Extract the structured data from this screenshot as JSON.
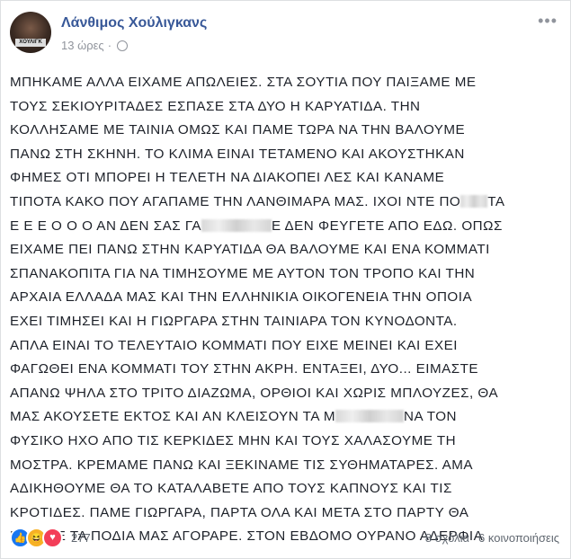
{
  "author": {
    "name": "Λάνθιμος Χούλιγκανς",
    "avatar_caption": "ΧΟΥΛΙΓΚ"
  },
  "time": "13 ώρες",
  "separator": "·",
  "menu_icon": "•••",
  "post_lines": [
    [
      "ΜΠΗΚΑΜΕ ΑΛΛΑ ΕΙΧΑΜΕ ΑΠΩΛΕΙΕΣ. ΣΤΑ ΣΟΥΤΙΑ ΠΟΥ ΠΑΙΞΑΜΕ ΜΕ"
    ],
    [
      "ΤΟΥΣ ΣΕΚΙΟΥΡΙΤΑΔΕΣ ΕΣΠΑΣΕ ΣΤΑ ΔΥΟ Η ΚΑΡΥΑΤΙΔΑ. ΤΗΝ"
    ],
    [
      "ΚΟΛΛΗΣΑΜΕ ΜΕ ΤΑΙΝΙΑ ΟΜΩΣ ΚΑΙ ΠΑΜΕ ΤΩΡΑ ΝΑ ΤΗΝ ΒΑΛΟΥΜΕ"
    ],
    [
      "ΠΑΝΩ ΣΤΗ ΣΚΗΝΗ. ΤΟ ΚΛΙΜΑ ΕΙΝΑΙ ΤΕΤΑΜΕΝΟ ΚΑΙ ΑΚΟΥΣΤΗΚΑΝ"
    ],
    [
      "ΦΗΜΕΣ ΟΤΙ ΜΠΟΡΕΙ Η ΤΕΛΕΤΗ ΝΑ ΔΙΑΚΟΠΕΙ ΛΕΣ ΚΑΙ ΚΑΝΑΜΕ"
    ],
    [
      "ΤΙΠΟΤΑ ΚΑΚΟ ΠΟΥ ΑΓΑΠΑΜΕ ΤΗΝ ΛΑΝΘΙΜΑΡΑ ΜΑΣ. ΙΧΟΙ ΝΤΕ ΠΟ",
      "ΤΑ"
    ],
    [
      "Ε Ε Ε Ο Ο Ο ΑΝ ΔΕΝ ΣΑΣ ΓΑ",
      "Ε ΔΕΝ ΦΕΥΓΕΤΕ ΑΠΟ ΕΔΩ. ΟΠΩΣ"
    ],
    [
      "ΕΙΧΑΜΕ ΠΕΙ ΠΑΝΩ ΣΤΗΝ ΚΑΡΥΑΤΙΔΑ ΘΑ ΒΑΛΟΥΜΕ ΚΑΙ ΕΝΑ ΚΟΜΜΑΤΙ"
    ],
    [
      "ΣΠΑΝΑΚΟΠΙΤΑ ΓΙΑ ΝΑ ΤΙΜΗΣΟΥΜΕ ΜΕ ΑΥΤΟΝ ΤΟΝ ΤΡΟΠΟ ΚΑΙ ΤΗΝ"
    ],
    [
      "ΑΡΧΑΙΑ ΕΛΛΑΔΑ ΜΑΣ ΚΑΙ ΤΗΝ ΕΛΛΗΝΙΚΙΑ ΟΙΚΟΓΕΝΕΙΑ ΤΗΝ ΟΠΟΙΑ"
    ],
    [
      "ΕΧΕΙ ΤΙΜΗΣΕΙ ΚΑΙ Η ΓΙΩΡΓΑΡΑ ΣΤΗΝ ΤΑΙΝΙΑΡΑ ΤΟΝ ΚΥΝΟΔΟΝΤΑ."
    ],
    [
      "ΑΠΛΑ ΕΙΝΑΙ ΤΟ ΤΕΛΕΥΤΑΙΟ ΚΟΜΜΑΤΙ ΠΟΥ ΕΙΧΕ ΜΕΙΝΕΙ ΚΑΙ ΕΧΕΙ"
    ],
    [
      "ΦΑΓΩΘΕΙ ΕΝΑ ΚΟΜΜΑΤΙ ΤΟΥ ΣΤΗΝ ΑΚΡΗ. ΕΝΤΑΞΕΙ, ΔΥΟ... ΕΙΜΑΣΤΕ"
    ],
    [
      "ΑΠΑΝΩ ΨΗΛΑ ΣΤΟ ΤΡΙΤΟ ΔΙΑΖΩΜΑ, ΟΡΘΙΟΙ ΚΑΙ ΧΩΡΙΣ ΜΠΛΟΥΖΕΣ, ΘΑ"
    ],
    [
      "ΜΑΣ ΑΚΟΥΣΕΤΕ ΕΚΤΟΣ ΚΑΙ ΑΝ ΚΛΕΙΣΟΥΝ ΤΑ Μ",
      "ΝΑ ΤΟΝ"
    ],
    [
      "ΦΥΣΙΚΟ ΗΧΟ ΑΠΟ ΤΙΣ ΚΕΡΚΙΔΕΣ ΜΗΝ ΚΑΙ ΤΟΥΣ ΧΑΛΑΣΟΥΜΕ ΤΗ"
    ],
    [
      "ΜΟΣΤΡΑ. ΚΡΕΜΑΜΕ ΠΑΝΩ ΚΑΙ ΞΕΚΙΝΑΜΕ ΤΙΣ ΣΥΘΗΜΑΤΑΡΕΣ. ΑΜΑ"
    ],
    [
      "ΑΔΙΚΗΘΟΥΜΕ ΘΑ ΤΟ ΚΑΤΑΛΑΒΕΤΕ ΑΠΟ ΤΟΥΣ ΚΑΠΝΟΥΣ ΚΑΙ ΤΙΣ"
    ],
    [
      "ΚΡΟΤΙΔΕΣ. ΠΑΜΕ ΓΙΩΡΓΑΡΑ, ΠΑΡΤΑ ΟΛΑ ΚΑΙ ΜΕΤΑ ΣΤΟ ΠΑΡΤΥ ΘΑ"
    ],
    [
      "ΠΙΟΥΜΕ ΤΑ ΠΟΔΙΑ ΜΑΣ ΑΓΟΡΑΡΕ. ΣΤΟΝ ΕΒΔΟΜΟ ΟΥΡΑΝΟ ΑΔΕΡΦΙΑ"
    ]
  ],
  "reactions": {
    "icons": [
      "like-icon",
      "haha-icon",
      "love-icon"
    ],
    "count": "277"
  },
  "comments": "8 σχόλια",
  "shares": "6 κοινοποιήσεις"
}
